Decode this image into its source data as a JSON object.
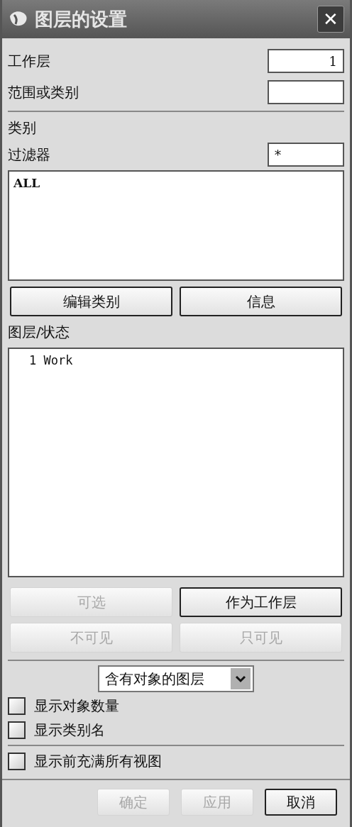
{
  "window": {
    "title": "图层的设置",
    "close": "✕"
  },
  "work_layer": {
    "label": "工作层",
    "value": "1"
  },
  "range": {
    "label": "范围或类别"
  },
  "category": {
    "heading": "类别",
    "filter_label": "过滤器",
    "filter_value": "*",
    "items": [
      "ALL"
    ]
  },
  "category_buttons": [
    {
      "label": "编辑类别",
      "disabled": false
    },
    {
      "label": "信息",
      "disabled": false
    }
  ],
  "layers": {
    "heading": "图层/状态",
    "items": [
      {
        "number": "1",
        "status": "Work"
      }
    ]
  },
  "layer_buttons": [
    {
      "label": "可选",
      "disabled": true
    },
    {
      "label": "作为工作层",
      "disabled": false
    },
    {
      "label": "不可见",
      "disabled": true
    },
    {
      "label": "只可见",
      "disabled": true
    }
  ],
  "show_dropdown": {
    "value": "含有对象的图层"
  },
  "options": [
    {
      "label": "显示对象数量",
      "checked": false
    },
    {
      "label": "显示类别名",
      "checked": false
    }
  ],
  "fit_option": {
    "label": "显示前充满所有视图",
    "checked": false
  },
  "footer_buttons": [
    {
      "label": "确定",
      "disabled": true
    },
    {
      "label": "应用",
      "disabled": true
    },
    {
      "label": "取消",
      "disabled": false
    }
  ]
}
